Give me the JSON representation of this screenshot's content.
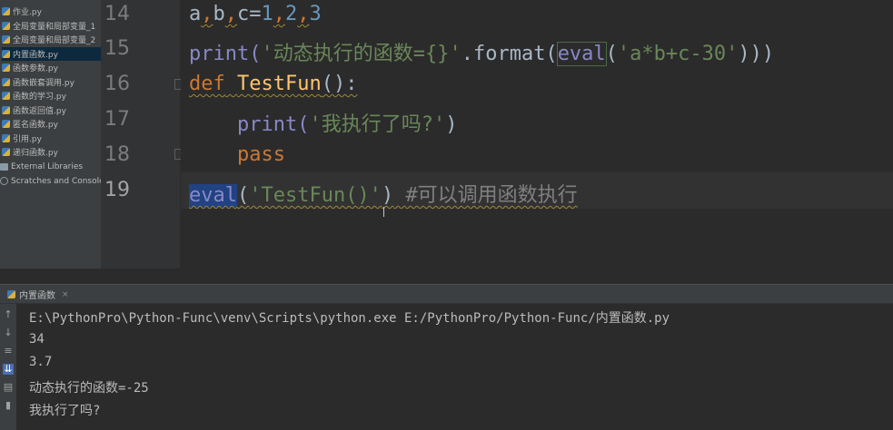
{
  "project_tree": {
    "items": [
      {
        "label": "作业.py",
        "kind": "py",
        "selected": false
      },
      {
        "label": "全局变量和局部变量_1",
        "kind": "py",
        "selected": false
      },
      {
        "label": "全局变量和局部变量_2",
        "kind": "py",
        "selected": false
      },
      {
        "label": "内置函数.py",
        "kind": "py",
        "selected": true
      },
      {
        "label": "函数参数.py",
        "kind": "py",
        "selected": false
      },
      {
        "label": "函数嵌套调用.py",
        "kind": "py",
        "selected": false
      },
      {
        "label": "函数的学习.py",
        "kind": "py",
        "selected": false
      },
      {
        "label": "函数返回值.py",
        "kind": "py",
        "selected": false
      },
      {
        "label": "匿名函数.py",
        "kind": "py",
        "selected": false
      },
      {
        "label": "引用.py",
        "kind": "py",
        "selected": false
      },
      {
        "label": "递归函数.py",
        "kind": "py",
        "selected": false
      },
      {
        "label": "External Libraries",
        "kind": "folder",
        "selected": false
      },
      {
        "label": "Scratches and Consoles",
        "kind": "scratch",
        "selected": false
      }
    ]
  },
  "editor": {
    "line_numbers": [
      "14",
      "15",
      "16",
      "17",
      "18",
      "19"
    ],
    "current_line": "19",
    "lines": {
      "l14": {
        "a": "a",
        "c1": ",",
        "b": "b",
        "c2": ",",
        "c": "c=",
        "n1": "1",
        "c3": ",",
        "n2": "2",
        "c4": ",",
        "n3": "3"
      },
      "l15": {
        "print": "print(",
        "str1": "'动态执行的函数={}'",
        "format": ".format(",
        "eval": "eval",
        "open": "(",
        "str2": "'a*b+c-30'",
        "close": ")))"
      },
      "l16": {
        "def": "def",
        "sp": " ",
        "name": "TestFun",
        "rest": "():"
      },
      "l17": {
        "indent": "    ",
        "print": "print(",
        "str": "'我执行了吗?'",
        "close": ")"
      },
      "l18": {
        "indent": "    ",
        "pass": "pass"
      },
      "l19": {
        "eval": "eval",
        "open": "(",
        "str": "'TestFun()'",
        "close": ")",
        "sp": " ",
        "comment": "#可以调用函数执行"
      }
    }
  },
  "run_panel": {
    "tab_label": "内置函数",
    "output": [
      "E:\\PythonPro\\Python-Func\\venv\\Scripts\\python.exe E:/PythonPro/Python-Func/内置函数.py",
      "34",
      "3.7",
      "动态执行的函数=-25",
      "我执行了吗?"
    ],
    "toolbar_icons": [
      "arrow-up-icon",
      "arrow-down-icon",
      "wrap-icon",
      "scroll-end-icon",
      "print-icon",
      "trash-icon"
    ]
  },
  "colors": {
    "editor_bg": "#2b2b2b",
    "panel_bg": "#3c3f41",
    "keyword": "#cc7832",
    "string": "#6a8759",
    "number": "#6897bb",
    "function": "#ffc66d",
    "builtin": "#8888c6",
    "comment": "#808080",
    "selection": "#214283"
  }
}
